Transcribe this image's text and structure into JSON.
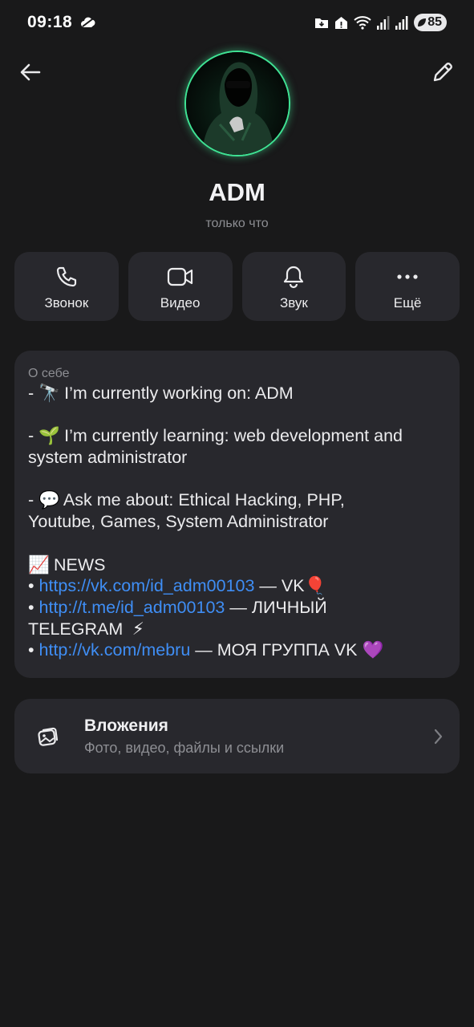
{
  "status_bar": {
    "time": "09:18",
    "battery": "85"
  },
  "header": {
    "back_icon": "arrow-left-icon",
    "edit_icon": "pencil-icon"
  },
  "profile": {
    "name": "ADM",
    "status": "только что",
    "avatar_accent": "#3fe394"
  },
  "actions": [
    {
      "icon": "phone-icon",
      "label": "Звонок"
    },
    {
      "icon": "video-camera-icon",
      "label": "Видео"
    },
    {
      "icon": "bell-icon",
      "label": "Звук"
    },
    {
      "icon": "more-icon",
      "label": "Ещё"
    }
  ],
  "about": {
    "title": "О себе",
    "working_prefix": "- ",
    "working_emoji": "🔭",
    "working_text": " I’m currently working on: ADM",
    "learning_prefix": "- ",
    "learning_emoji": "🌱",
    "learning_text_1": " I’m currently learning: web development and",
    "learning_text_2": "system administrator",
    "ask_prefix": "- ",
    "ask_emoji": "💬",
    "ask_text_1": " Ask me about: Ethical Hacking, PHP,",
    "ask_text_2": "Youtube, Games, System Administrator",
    "news_emoji": "📈",
    "news_text": " NEWS",
    "bullet": "• ",
    "link_1": "https://vk.com/id_adm00103",
    "link_1_suffix": "  — VK",
    "link_1_emoji": "🎈",
    "link_2": "http://t.me/id_adm00103",
    "link_2_suffix": " — ЛИЧНЫЙ",
    "link_2_suffix_2": "TELEGRAM",
    "link_2_emoji": "⚡",
    "link_3": "http://vk.com/mebru",
    "link_3_suffix": " — МОЯ ГРУППА VK",
    "link_3_emoji": "💜",
    "link_color": "#3f8ef5"
  },
  "attachments": {
    "icon": "gallery-icon",
    "title": "Вложения",
    "subtitle": "Фото, видео, файлы и ссылки",
    "chevron": "chevron-right-icon"
  }
}
